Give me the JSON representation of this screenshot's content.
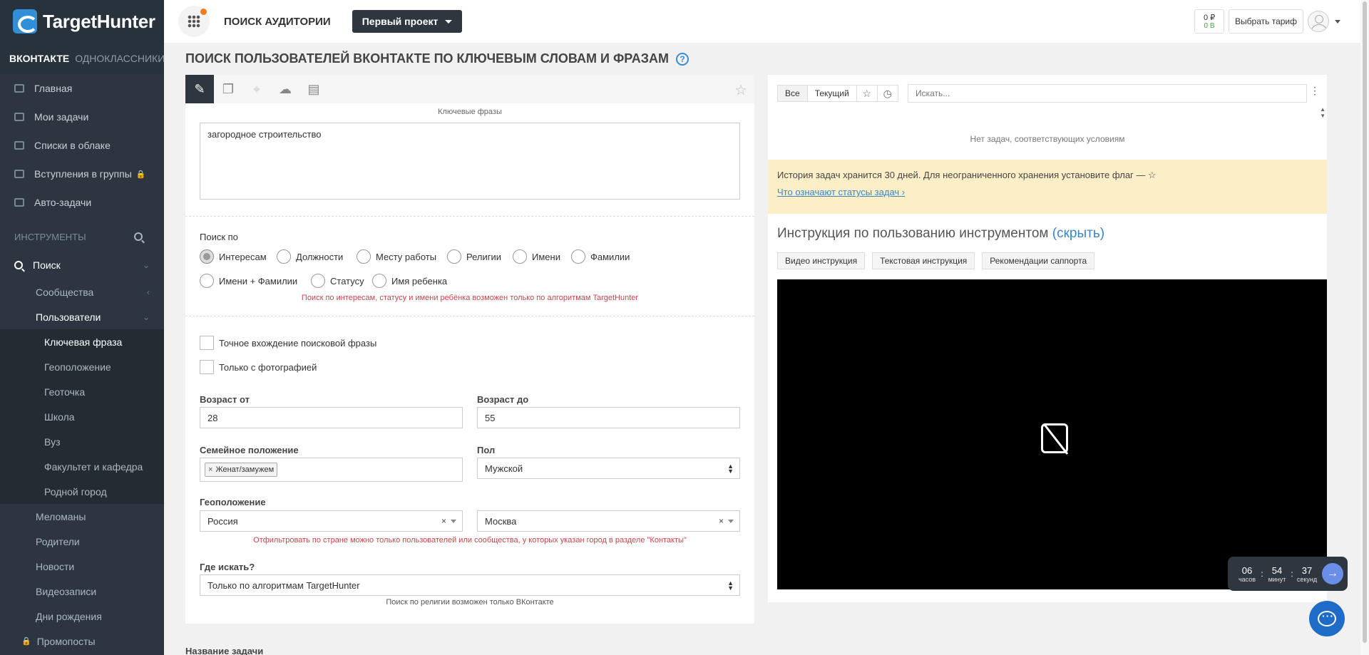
{
  "brand": {
    "name": "TargetHunter"
  },
  "sidebar": {
    "networks": [
      "ВКОНТАКТЕ",
      "ОДНОКЛАССНИКИ"
    ],
    "main_items": [
      "Главная",
      "Мои задачи",
      "Списки в облаке",
      "Вступления в группы",
      "Авто-задачи"
    ],
    "tools_header": "ИНСТРУМЕНТЫ",
    "search_label": "Поиск",
    "sub_items": [
      "Сообщества",
      "Пользователи"
    ],
    "user_items": [
      "Ключевая фраза",
      "Геоположение",
      "Геоточка",
      "Школа",
      "Вуз",
      "Факультет и кафедра",
      "Родной город"
    ],
    "more_items": [
      "Меломаны",
      "Родители",
      "Новости",
      "Видеозаписи",
      "Дни рождения",
      "Промопосты"
    ]
  },
  "topbar": {
    "title": "ПОИСК АУДИТОРИИ",
    "project": "Первый проект",
    "balance_rub": "0 ₽",
    "balance_b": "0 B",
    "tariff": "Выбрать тариф"
  },
  "heading": "ПОИСК ПОЛЬЗОВАТЕЛЕЙ ВКОНТАКТЕ ПО КЛЮЧЕВЫМ СЛОВАМ И ФРАЗАМ",
  "form": {
    "keywords_label": "Ключевые фразы",
    "keywords_value": "загородное строительство",
    "search_by_label": "Поиск по",
    "search_by_options": [
      "Интересам",
      "Должности",
      "Месту работы",
      "Религии",
      "Имени",
      "Фамилии",
      "Имени + Фамилии",
      "Статусу",
      "Имя ребенка"
    ],
    "search_by_warning": "Поиск по интересам, статусу и имени ребёнка возможен только по алгоритмам TargetHunter",
    "exact_match": "Точное вхождение поисковой фразы",
    "with_photo": "Только с фотографией",
    "age_from_label": "Возраст от",
    "age_from": "28",
    "age_to_label": "Возраст до",
    "age_to": "55",
    "family_label": "Семейное положение",
    "family_tag": "Женат/замужем",
    "gender_label": "Пол",
    "gender": "Мужской",
    "geo_label": "Геоположение",
    "country": "Россия",
    "city": "Москва",
    "geo_warning": "Отфильтровать по стране можно только пользователей или сообщества, у которых указан город в разделе \"Контакты\"",
    "where_label": "Где искать?",
    "where_value": "Только по алгоритмам TargetHunter",
    "where_note": "Поиск по религии возможен только ВКонтакте",
    "task_name_label": "Название задачи"
  },
  "tasks": {
    "filter_all": "Все",
    "filter_current": "Текущий",
    "search_placeholder": "Искать...",
    "empty": "Нет задач, соответствующих условиям",
    "history_text": "История задач хранится 30 дней. Для неограниченного хранения установите флаг —",
    "history_link": "Что означают статусы задач"
  },
  "instructions": {
    "title": "Инструкция по пользованию инструментом",
    "hide": "(скрыть)",
    "tabs": [
      "Видео инструкция",
      "Текстовая инструкция",
      "Рекомендации саппорта"
    ]
  },
  "timer": {
    "hours": "06",
    "hours_label": "часов",
    "minutes": "54",
    "minutes_label": "минут",
    "seconds": "37",
    "seconds_label": "секунд"
  }
}
